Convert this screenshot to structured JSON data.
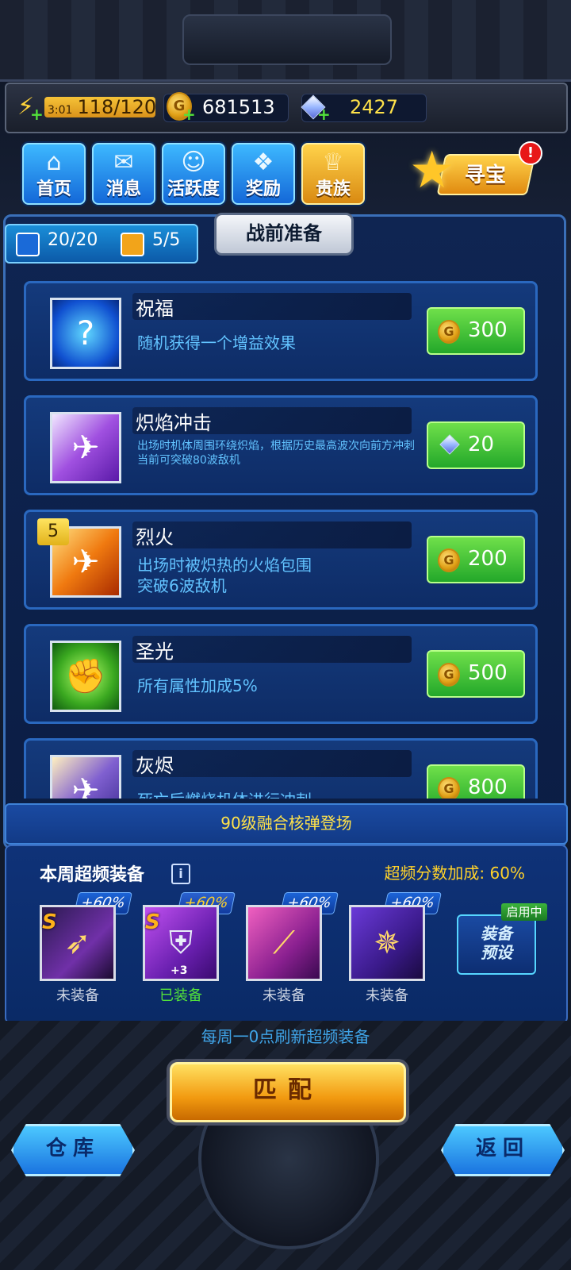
{
  "resources": {
    "energy_timer": "3:01",
    "energy": "118/120",
    "coins": "681513",
    "diamonds": "2427"
  },
  "menu": [
    {
      "label": "首页",
      "icon": "home-icon"
    },
    {
      "label": "消息",
      "icon": "message-icon"
    },
    {
      "label": "活跃度",
      "icon": "activity-icon"
    },
    {
      "label": "奖励",
      "icon": "gift-icon"
    },
    {
      "label": "贵族",
      "icon": "noble-icon"
    }
  ],
  "treasure": {
    "label": "寻宝",
    "badge": "!"
  },
  "panel": {
    "tab_title": "战前准备",
    "counter_a": "20/20",
    "counter_b": "5/5"
  },
  "items": [
    {
      "name": "祝福",
      "desc": "随机获得一个增益效果",
      "price": "300",
      "currency": "coin"
    },
    {
      "name": "炽焰冲击",
      "desc": "出场时机体周围环绕炽焰，根据历史最高波次向前方冲刺",
      "desc2": "当前可突破80波敌机",
      "price": "20",
      "currency": "diamond"
    },
    {
      "name": "烈火",
      "desc": "出场时被炽热的火焰包围",
      "desc2": "突破6波敌机",
      "price": "200",
      "currency": "coin",
      "level": "5"
    },
    {
      "name": "圣光",
      "desc": "所有属性加成5%",
      "price": "500",
      "currency": "coin"
    },
    {
      "name": "灰烬",
      "desc": "死亡后燃烧机体进行冲刺",
      "price": "800",
      "currency": "coin"
    }
  ],
  "news": "90级融合核弹登场",
  "weekly": {
    "title": "本周超频装备",
    "bonus_label": "超频分数加成: 60%",
    "equipment": [
      {
        "rank": "S",
        "bonus": "+60%",
        "state": "未装备",
        "plus": ""
      },
      {
        "rank": "S",
        "bonus": "+60%",
        "state": "已装备",
        "plus": "+3"
      },
      {
        "rank": "",
        "bonus": "+60%",
        "state": "未装备",
        "plus": ""
      },
      {
        "rank": "",
        "bonus": "+60%",
        "state": "未装备",
        "plus": ""
      }
    ],
    "preset_label": "装备预设",
    "preset_status": "启用中",
    "refresh_note": "每周一0点刷新超频装备"
  },
  "buttons": {
    "match": "匹配",
    "warehouse": "仓库",
    "back": "返回"
  },
  "colors": {
    "accent_blue": "#2a68bf",
    "buy_green": "#23a82a",
    "gold": "#f29a10",
    "highlight_yellow": "#ffd22a"
  }
}
